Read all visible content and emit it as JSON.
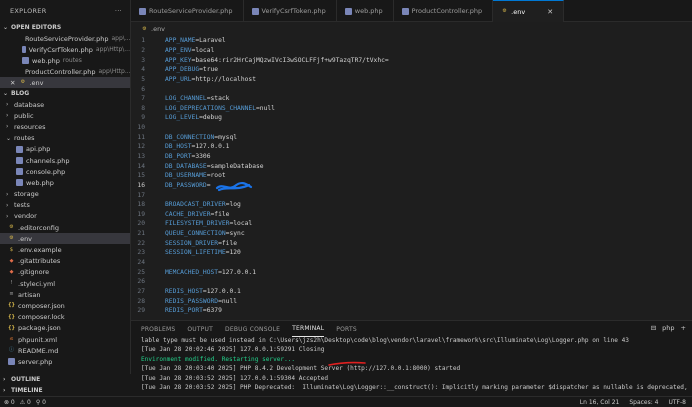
{
  "explorer": {
    "title": "EXPLORER",
    "more": "···",
    "open_editors_label": "OPEN EDITORS",
    "open_editors": [
      {
        "name": "RouteServiceProvider.php",
        "desc": "app\\..."
      },
      {
        "name": "VerifyCsrfToken.php",
        "desc": "app\\Http\\..."
      },
      {
        "name": "web.php",
        "desc": "routes"
      },
      {
        "name": "ProductController.php",
        "desc": "app\\Http..."
      },
      {
        "name": ".env",
        "desc": ""
      }
    ],
    "project_label": "BLOG",
    "tree": [
      {
        "name": "database",
        "type": "folder",
        "indent": 1
      },
      {
        "name": "public",
        "type": "folder",
        "indent": 1
      },
      {
        "name": "resources",
        "type": "folder",
        "indent": 1
      },
      {
        "name": "routes",
        "type": "folder-open",
        "indent": 1
      },
      {
        "name": "api.php",
        "type": "php",
        "indent": 2
      },
      {
        "name": "channels.php",
        "type": "php",
        "indent": 2
      },
      {
        "name": "console.php",
        "type": "php",
        "indent": 2
      },
      {
        "name": "web.php",
        "type": "php",
        "indent": 2
      },
      {
        "name": "storage",
        "type": "folder",
        "indent": 1
      },
      {
        "name": "tests",
        "type": "folder",
        "indent": 1
      },
      {
        "name": "vendor",
        "type": "folder",
        "indent": 1
      },
      {
        "name": ".editorconfig",
        "type": "gear",
        "indent": 1
      },
      {
        "name": ".env",
        "type": "gear",
        "indent": 1,
        "selected": true
      },
      {
        "name": ".env.example",
        "type": "env",
        "indent": 1
      },
      {
        "name": ".gitattributes",
        "type": "git",
        "indent": 1
      },
      {
        "name": ".gitignore",
        "type": "git",
        "indent": 1
      },
      {
        "name": ".styleci.yml",
        "type": "yml",
        "indent": 1
      },
      {
        "name": "artisan",
        "type": "file",
        "indent": 1
      },
      {
        "name": "composer.json",
        "type": "json",
        "indent": 1
      },
      {
        "name": "composer.lock",
        "type": "lock",
        "indent": 1
      },
      {
        "name": "package.json",
        "type": "json",
        "indent": 1
      },
      {
        "name": "phpunit.xml",
        "type": "xml",
        "indent": 1
      },
      {
        "name": "README.md",
        "type": "md",
        "indent": 1
      },
      {
        "name": "server.php",
        "type": "php",
        "indent": 1
      }
    ],
    "outline_label": "OUTLINE",
    "timeline_label": "TIMELINE"
  },
  "tabs": [
    {
      "name": "RouteServiceProvider.php",
      "active": false
    },
    {
      "name": "VerifyCsrfToken.php",
      "active": false
    },
    {
      "name": "web.php",
      "active": false
    },
    {
      "name": "ProductController.php",
      "active": false
    },
    {
      "name": ".env",
      "active": true
    }
  ],
  "breadcrumb": ".env",
  "editor": {
    "current_line": 16,
    "lines": [
      {
        "n": 1,
        "key": "APP_NAME",
        "val": "Laravel"
      },
      {
        "n": 2,
        "key": "APP_ENV",
        "val": "local"
      },
      {
        "n": 3,
        "key": "APP_KEY",
        "val": "base64:rir2HrCajMQzwIVcI3wSOCLFFjf+w9TazqTR7/tVxhc="
      },
      {
        "n": 4,
        "key": "APP_DEBUG",
        "val": "true"
      },
      {
        "n": 5,
        "key": "APP_URL",
        "val": "http://localhost"
      },
      {
        "n": 6,
        "key": "",
        "val": ""
      },
      {
        "n": 7,
        "key": "LOG_CHANNEL",
        "val": "stack"
      },
      {
        "n": 8,
        "key": "LOG_DEPRECATIONS_CHANNEL",
        "val": "null"
      },
      {
        "n": 9,
        "key": "LOG_LEVEL",
        "val": "debug"
      },
      {
        "n": 10,
        "key": "",
        "val": ""
      },
      {
        "n": 11,
        "key": "DB_CONNECTION",
        "val": "mysql"
      },
      {
        "n": 12,
        "key": "DB_HOST",
        "val": "127.0.0.1"
      },
      {
        "n": 13,
        "key": "DB_PORT",
        "val": "3306"
      },
      {
        "n": 14,
        "key": "DB_DATABASE",
        "val": "sampleDatabase"
      },
      {
        "n": 15,
        "key": "DB_USERNAME",
        "val": "root"
      },
      {
        "n": 16,
        "key": "DB_PASSWORD",
        "val": ""
      },
      {
        "n": 17,
        "key": "",
        "val": ""
      },
      {
        "n": 18,
        "key": "BROADCAST_DRIVER",
        "val": "log"
      },
      {
        "n": 19,
        "key": "CACHE_DRIVER",
        "val": "file"
      },
      {
        "n": 20,
        "key": "FILESYSTEM_DRIVER",
        "val": "local"
      },
      {
        "n": 21,
        "key": "QUEUE_CONNECTION",
        "val": "sync"
      },
      {
        "n": 22,
        "key": "SESSION_DRIVER",
        "val": "file"
      },
      {
        "n": 23,
        "key": "SESSION_LIFETIME",
        "val": "120"
      },
      {
        "n": 24,
        "key": "",
        "val": ""
      },
      {
        "n": 25,
        "key": "MEMCACHED_HOST",
        "val": "127.0.0.1"
      },
      {
        "n": 26,
        "key": "",
        "val": ""
      },
      {
        "n": 27,
        "key": "REDIS_HOST",
        "val": "127.0.0.1"
      },
      {
        "n": 28,
        "key": "REDIS_PASSWORD",
        "val": "null"
      },
      {
        "n": 29,
        "key": "REDIS_PORT",
        "val": "6379"
      }
    ]
  },
  "panel": {
    "tabs": [
      "PROBLEMS",
      "OUTPUT",
      "DEBUG CONSOLE",
      "TERMINAL",
      "PORTS"
    ],
    "active_tab": "TERMINAL",
    "shell": "php",
    "add": "+",
    "lines": [
      {
        "text": "lable type must be used instead in C:\\Users\\jzs2h\\Desktop\\code\\blog\\vendor\\laravel\\framework\\src\\Illuminate\\Log\\Logger.php on line 43",
        "color": "normal"
      },
      {
        "text": "[Tue Jan 28 20:02:46 2025] 127.0.0.1:59291 Closing",
        "color": "normal"
      },
      {
        "text": "Environment modified. Restarting server...",
        "color": "green"
      },
      {
        "text": "[Tue Jan 28 20:03:40 2025] PHP 8.4.2 Development Server (http://127.0.0.1:8000) started",
        "color": "normal"
      },
      {
        "text": "[Tue Jan 28 20:03:52 2025] 127.0.0.1:59304 Accepted",
        "color": "normal"
      },
      {
        "text": "[Tue Jan 28 20:03:52 2025] PHP Deprecated:  Illuminate\\Log\\Logger::__construct(): Implicitly marking parameter $dispatcher as nullable is deprecated,",
        "color": "normal"
      }
    ]
  },
  "status": {
    "errors": "⊗ 0",
    "warnings": "⚠ 0",
    "ports": "⚲ 0",
    "position": "Ln 16, Col 21",
    "spaces": "Spaces: 4",
    "encoding": "UTF-8"
  },
  "colors": {
    "accent": "#0078d4",
    "terminal_green": "#23d18b",
    "scribble_blue": "#1a73e8",
    "underline_red": "#e02020"
  }
}
